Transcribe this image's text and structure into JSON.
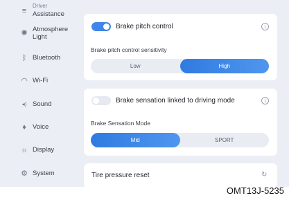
{
  "sidebar": {
    "top_peek": "Driver",
    "items": [
      {
        "label": "Assistance",
        "icon": "assistance-icon",
        "glyph": "≡"
      },
      {
        "label": "Atmosphere\nLight",
        "icon": "atmosphere-light-icon",
        "glyph": "✺"
      },
      {
        "label": "Bluetooth",
        "icon": "bluetooth-icon",
        "glyph": "ᛒ"
      },
      {
        "label": "Wi-Fi",
        "icon": "wifi-icon",
        "glyph": "◠"
      },
      {
        "label": "Sound",
        "icon": "sound-icon",
        "glyph": "◂)"
      },
      {
        "label": "Voice",
        "icon": "voice-icon",
        "glyph": "♦"
      },
      {
        "label": "Display",
        "icon": "display-icon",
        "glyph": "☼"
      },
      {
        "label": "System",
        "icon": "system-icon",
        "glyph": "⚙"
      }
    ]
  },
  "brake_pitch": {
    "title": "Brake pitch control",
    "enabled": true,
    "sensitivity_label": "Brake pitch control sensitivity",
    "options": [
      "Low",
      "High"
    ],
    "selected": "High"
  },
  "brake_sensation": {
    "title": "Brake sensation linked to driving mode",
    "enabled": false,
    "mode_label": "Brake Sensation Mode",
    "options": [
      "Mid",
      "SPORT"
    ],
    "selected": "Mid"
  },
  "tire_pressure": {
    "title": "Tire pressure reset"
  },
  "caption": "OMT13J-5235",
  "colors": {
    "accent": "#3f86e8",
    "background": "#ebeef4",
    "card": "#ffffff"
  }
}
